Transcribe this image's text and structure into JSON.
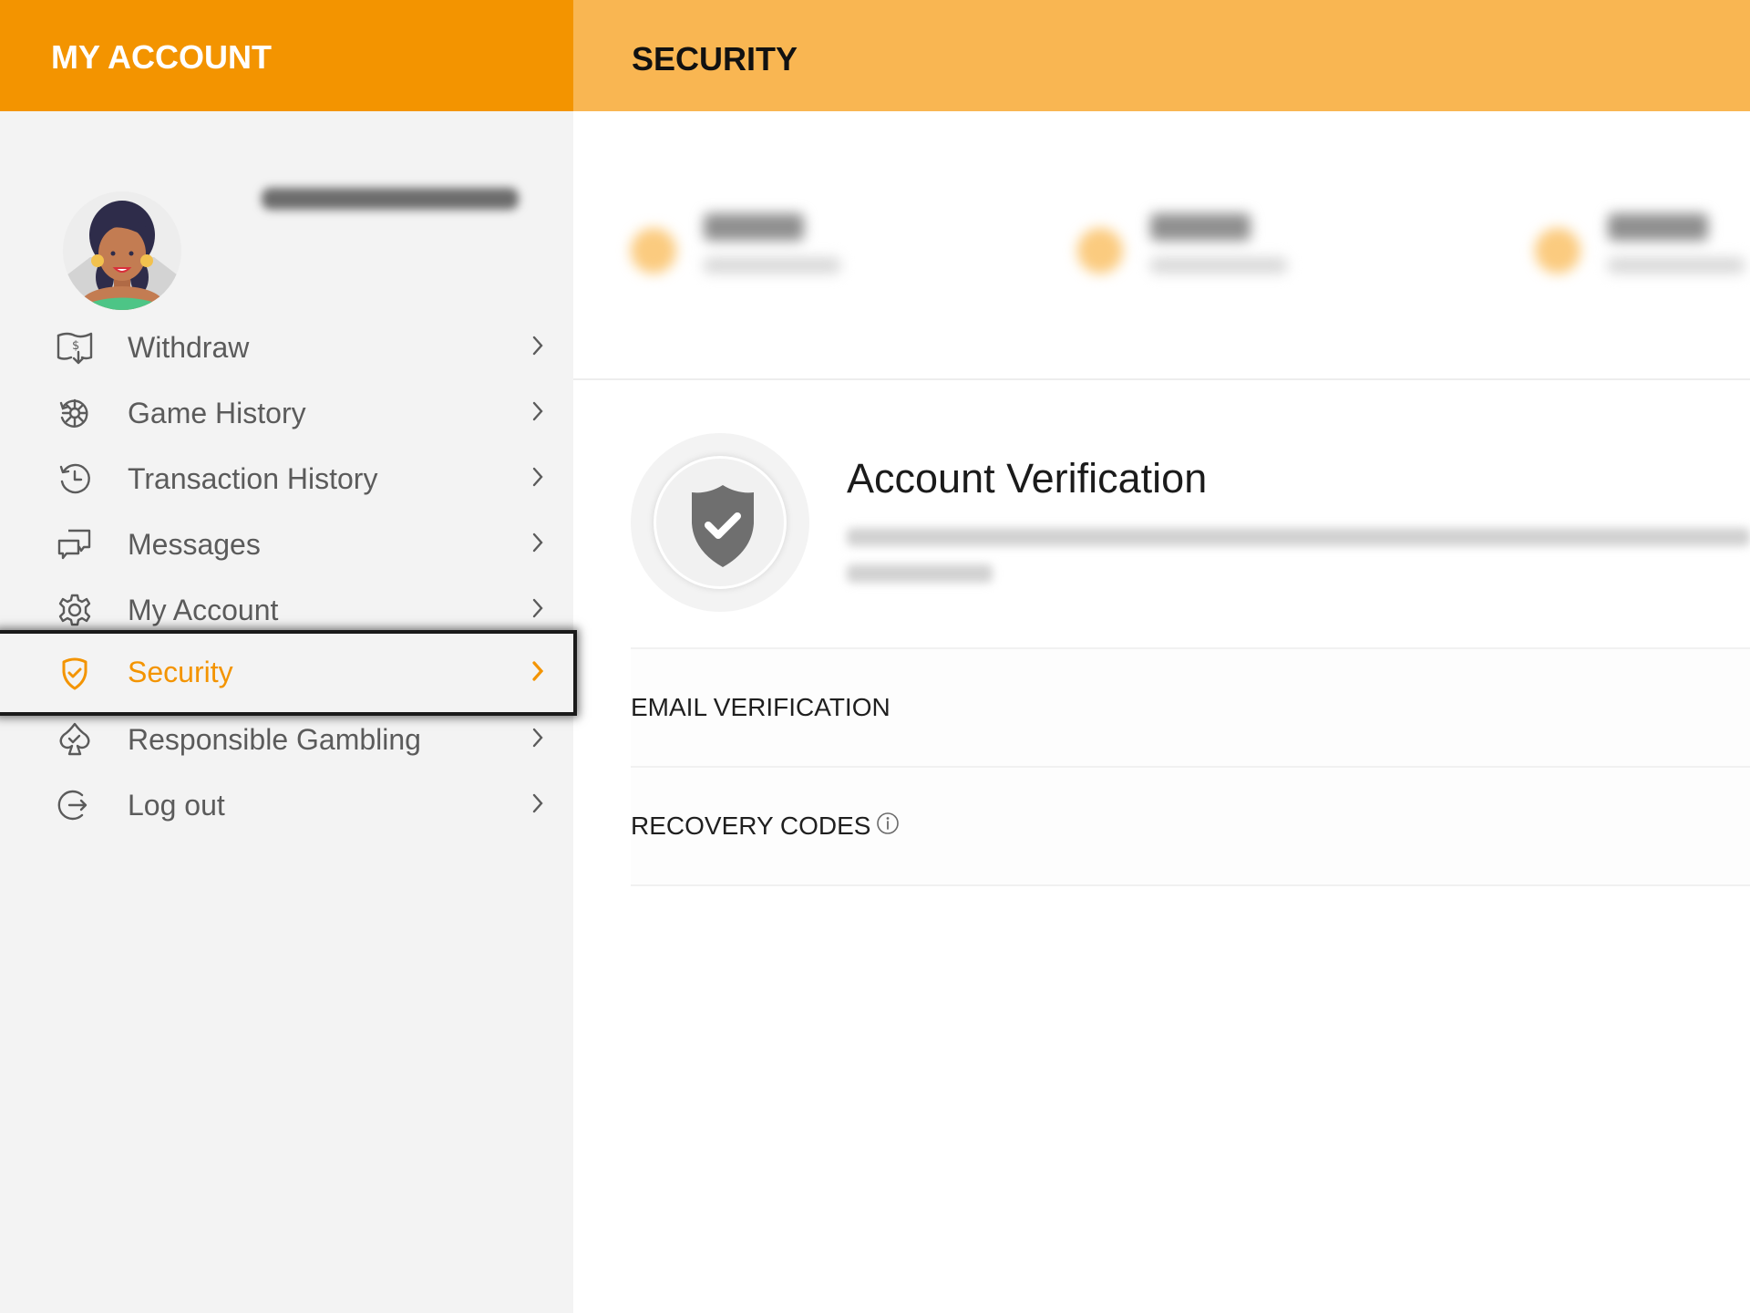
{
  "sidebar": {
    "header_title": "MY ACCOUNT",
    "user": {
      "avatar": "avatar-woman-illustration",
      "username_blurred": true
    },
    "items": [
      {
        "label": "Withdraw",
        "icon": "withdraw-money-icon",
        "active": false
      },
      {
        "label": "Game History",
        "icon": "game-history-icon",
        "active": false
      },
      {
        "label": "Transaction History",
        "icon": "history-clock-icon",
        "active": false
      },
      {
        "label": "Messages",
        "icon": "chat-bubbles-icon",
        "active": false
      },
      {
        "label": "My Account",
        "icon": "gear-icon",
        "active": false
      },
      {
        "label": "Security",
        "icon": "shield-check-icon",
        "active": true
      },
      {
        "label": "Responsible Gambling",
        "icon": "spade-check-icon",
        "active": false
      },
      {
        "label": "Log out",
        "icon": "logout-icon",
        "active": false
      }
    ]
  },
  "main": {
    "header_title": "SECURITY",
    "stats_blurred": 3,
    "verification": {
      "title": "Account Verification",
      "icon": "shield-check-icon",
      "description_blurred": true
    },
    "rows": [
      {
        "label": "EMAIL VERIFICATION",
        "info_icon": false
      },
      {
        "label": "RECOVERY CODES",
        "info_icon": true
      }
    ]
  },
  "colors": {
    "sidebar_header": "#F39400",
    "main_header": "#F9B652",
    "accent": "#F39400",
    "sidebar_bg": "#F3F3F3",
    "menu_text": "#5B5B5B",
    "badge_shield": "#6F6F6F"
  }
}
